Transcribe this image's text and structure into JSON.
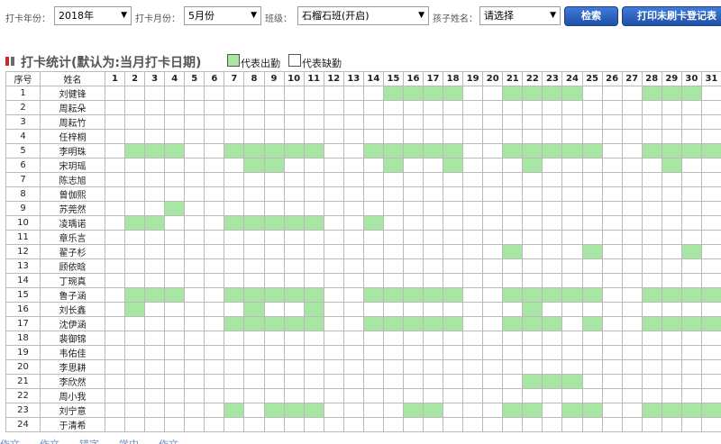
{
  "toolbar": {
    "year_label": "打卡年份：",
    "year_value": "2018年",
    "month_label": "打卡月份：",
    "month_value": "5月份",
    "class_label": "班级：",
    "class_value": "石榴石班(开启)",
    "child_label": "孩子姓名：",
    "child_value": "请选择",
    "search_button": "检索",
    "print_button": "打印未刷卡登记表"
  },
  "section": {
    "title": "打卡统计(默认为:当月打卡日期)",
    "legend_present": "代表出勤",
    "legend_absent": "代表缺勤"
  },
  "colors": {
    "present": "#a8e6a3",
    "button": "#2a5fba",
    "marker": "#c0302b"
  },
  "table": {
    "header_no": "序号",
    "header_name": "姓名",
    "days": [
      "1",
      "2",
      "3",
      "4",
      "5",
      "6",
      "7",
      "8",
      "9",
      "10",
      "11",
      "12",
      "13",
      "14",
      "15",
      "16",
      "17",
      "18",
      "19",
      "20",
      "21",
      "22",
      "23",
      "24",
      "25",
      "26",
      "27",
      "28",
      "29",
      "30",
      "31"
    ],
    "rows": [
      {
        "no": "1",
        "name": "刘健锋",
        "present": [
          15,
          16,
          17,
          18,
          21,
          22,
          23,
          24,
          28,
          29,
          30
        ]
      },
      {
        "no": "2",
        "name": "周耘朵",
        "present": []
      },
      {
        "no": "3",
        "name": "周耘竹",
        "present": []
      },
      {
        "no": "4",
        "name": "任梓桐",
        "present": []
      },
      {
        "no": "5",
        "name": "李明珠",
        "present": [
          2,
          3,
          4,
          7,
          8,
          9,
          10,
          11,
          14,
          15,
          16,
          17,
          18,
          21,
          22,
          23,
          24,
          25,
          28,
          29,
          30,
          31
        ]
      },
      {
        "no": "6",
        "name": "宋玥瑶",
        "present": [
          8,
          9,
          15,
          18,
          22,
          29
        ]
      },
      {
        "no": "7",
        "name": "陈志旭",
        "present": []
      },
      {
        "no": "8",
        "name": "曾伽熙",
        "present": []
      },
      {
        "no": "9",
        "name": "苏莞然",
        "present": [
          4
        ]
      },
      {
        "no": "10",
        "name": "凌瑀诺",
        "present": [
          2,
          3,
          7,
          8,
          9,
          10,
          11,
          14
        ]
      },
      {
        "no": "11",
        "name": "章乐言",
        "present": []
      },
      {
        "no": "12",
        "name": "翟子杉",
        "present": [
          21,
          25,
          30
        ]
      },
      {
        "no": "13",
        "name": "顾依晗",
        "present": []
      },
      {
        "no": "14",
        "name": "丁琬真",
        "present": []
      },
      {
        "no": "15",
        "name": "鲁子涵",
        "present": [
          2,
          3,
          4,
          7,
          8,
          9,
          10,
          11,
          14,
          15,
          16,
          17,
          18,
          21,
          22,
          23,
          24,
          25,
          28,
          29,
          30,
          31
        ]
      },
      {
        "no": "16",
        "name": "刘长鑫",
        "present": [
          2,
          8,
          11,
          22
        ]
      },
      {
        "no": "17",
        "name": "沈伊涵",
        "present": [
          7,
          8,
          9,
          10,
          11,
          14,
          15,
          16,
          17,
          18,
          21,
          22,
          23,
          25,
          28,
          29,
          30,
          31
        ]
      },
      {
        "no": "18",
        "name": "裴御锦",
        "present": []
      },
      {
        "no": "19",
        "name": "韦佑佳",
        "present": []
      },
      {
        "no": "20",
        "name": "李思耕",
        "present": []
      },
      {
        "no": "21",
        "name": "李欣然",
        "present": [
          22,
          23,
          24
        ]
      },
      {
        "no": "22",
        "name": "周小我",
        "present": []
      },
      {
        "no": "23",
        "name": "刘宁意",
        "present": [
          7,
          9,
          10,
          11,
          16,
          17,
          21,
          22,
          24,
          25,
          28,
          29,
          30,
          31
        ]
      },
      {
        "no": "24",
        "name": "于清希",
        "present": []
      }
    ]
  },
  "footer": {
    "links": [
      "作文",
      "作文",
      "错字",
      "学中",
      "作文"
    ]
  }
}
